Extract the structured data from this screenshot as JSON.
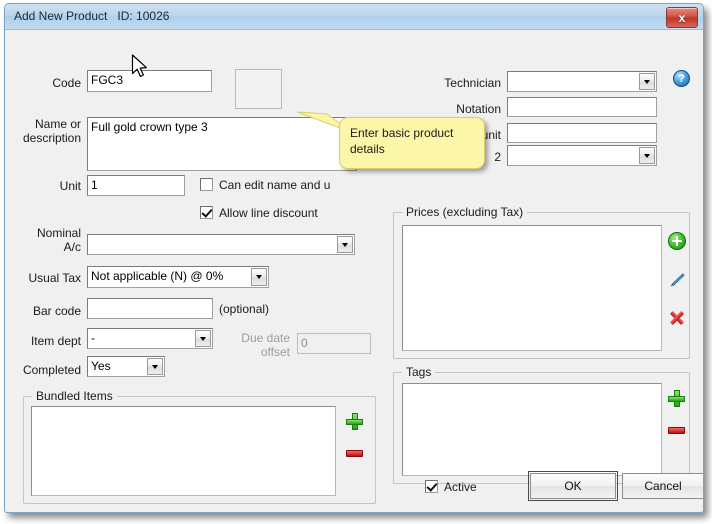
{
  "window": {
    "title": "Add New Product   ID: 10026",
    "close_label": "x"
  },
  "left_form": {
    "code_label": "Code",
    "code_value": "FGC3",
    "name_label": "Name or\ndescription",
    "name_value": "Full gold crown type 3",
    "unit_label": "Unit",
    "unit_value": "1",
    "can_edit_label": "Can edit name and u",
    "allow_discount_label": "Allow line discount",
    "nominal_label": "Nominal\nA/c",
    "nominal_value": "",
    "usual_tax_label": "Usual Tax",
    "usual_tax_value": "Not applicable (N) @ 0%",
    "bar_code_label": "Bar code",
    "bar_code_value": "",
    "optional_label": "(optional)",
    "item_dept_label": "Item dept",
    "item_dept_value": "-",
    "due_date_label": "Due date\noffset",
    "due_date_value": "0",
    "completed_label": "Completed",
    "completed_value": "Yes"
  },
  "right_form": {
    "technician_label": "Technician",
    "technician_value": "",
    "notation_label": "Notation",
    "notation_value": "",
    "work_time_label": "Work time per unit",
    "work_time_value": "",
    "field4_label": "2",
    "field4_value": ""
  },
  "bundled_items": {
    "title": "Bundled Items",
    "items": []
  },
  "prices": {
    "title": "Prices (excluding Tax)",
    "items": []
  },
  "tags": {
    "title": "Tags",
    "items": []
  },
  "footer": {
    "active_label": "Active",
    "ok_label": "OK",
    "cancel_label": "Cancel"
  },
  "callout": {
    "text": "Enter basic product details"
  },
  "help": {
    "glyph": "?"
  },
  "colors": {
    "titlebar": "#accfea",
    "dialog_bg": "#f0f0f0",
    "callout_bg": "#fcf7a8",
    "close_red": "#bc372b",
    "add_green": "#22a617",
    "remove_red": "#c00d0d"
  }
}
